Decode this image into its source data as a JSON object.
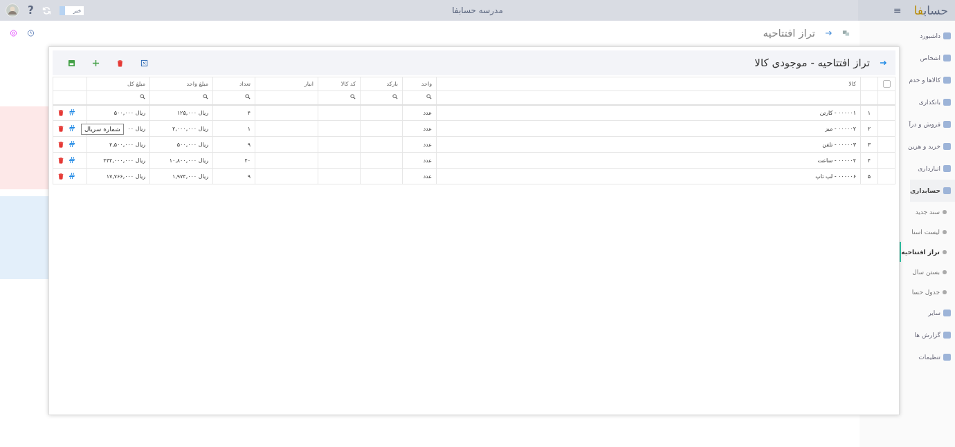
{
  "topbar": {
    "logo": {
      "main": "حساب",
      "accent": "فا"
    },
    "title": "مدرسه حسابفا",
    "news_label": "خبر",
    "menu_glyph": "≡",
    "help_glyph": "?"
  },
  "sidebar": {
    "items": [
      {
        "label": "داشبورد",
        "selected": false
      },
      {
        "label": "اشخاص",
        "selected": false
      },
      {
        "label": "کالاها و خدم",
        "selected": false
      },
      {
        "label": "بانکداری",
        "selected": false
      },
      {
        "label": "فروش و درآ",
        "selected": false
      },
      {
        "label": "خرید و هزین",
        "selected": false
      },
      {
        "label": "انبارداری",
        "selected": false
      },
      {
        "label": "حسابداری",
        "selected": false,
        "expanded": true,
        "children": [
          {
            "label": "سند جدید",
            "selected": false
          },
          {
            "label": "لیست اسنا",
            "selected": false
          },
          {
            "label": "تراز افتتاحیه",
            "selected": true
          },
          {
            "label": "بستن سال",
            "selected": false
          },
          {
            "label": "جدول حسا",
            "selected": false
          }
        ]
      },
      {
        "label": "سایر",
        "selected": false
      },
      {
        "label": "گزارش ها",
        "selected": false
      },
      {
        "label": "تنظیمات",
        "selected": false
      }
    ]
  },
  "page": {
    "title": "تراز افتتاحیه"
  },
  "dialog": {
    "title": "تراز افتتاحیه - موجودی کالا",
    "columns": [
      {
        "label": "کالا",
        "searchable": false
      },
      {
        "label": "واحد",
        "searchable": true
      },
      {
        "label": "بارکد",
        "searchable": true
      },
      {
        "label": "کد کالا",
        "searchable": true
      },
      {
        "label": "انبار",
        "searchable": false
      },
      {
        "label": "تعداد",
        "searchable": true
      },
      {
        "label": "مبلغ واحد",
        "searchable": true
      },
      {
        "label": "مبلغ کل",
        "searchable": true
      }
    ],
    "select_all": {
      "checked": false
    },
    "rows": [
      {
        "number": "۱",
        "item": "۰۰۰۰۰۱ - کارتن",
        "unit": "عدد",
        "quantity": "۴",
        "unit_price": "ریال ۱۲۵,۰۰۰",
        "total": "ریال ۵۰۰,۰۰۰",
        "hash": "#"
      },
      {
        "number": "۲",
        "item": "۰۰۰۰۰۲ - میز",
        "unit": "عدد",
        "quantity": "۱",
        "unit_price": "ریال ۲,۰۰۰,۰۰۰",
        "total": "ریال ۰۰",
        "hash": "#",
        "tooltip": "شماره سریال"
      },
      {
        "number": "۳",
        "item": "۰۰۰۰۰۳ - تلفن",
        "unit": "عدد",
        "quantity": "۹",
        "unit_price": "ریال ۵۰۰,۰۰۰",
        "total": "ریال ۴,۵۰۰,۰۰۰",
        "hash": "#"
      },
      {
        "number": "۴",
        "item": "۰۰۰۰۰۴ - ساعت",
        "unit": "عدد",
        "quantity": "۴۰",
        "unit_price": "ریال ۱۰,۸۰۰,۰۰۰",
        "total": "ریال ۴۳۲,۰۰۰,۰۰۰",
        "hash": "#"
      },
      {
        "number": "۵",
        "item": "۰۰۰۰۰۶ - لپ تاپ",
        "unit": "عدد",
        "quantity": "۹",
        "unit_price": "ریال ۱,۹۷۴,۰۰۰",
        "total": "ریال ۱۷,۷۶۶,۰۰۰",
        "hash": "#"
      }
    ]
  }
}
